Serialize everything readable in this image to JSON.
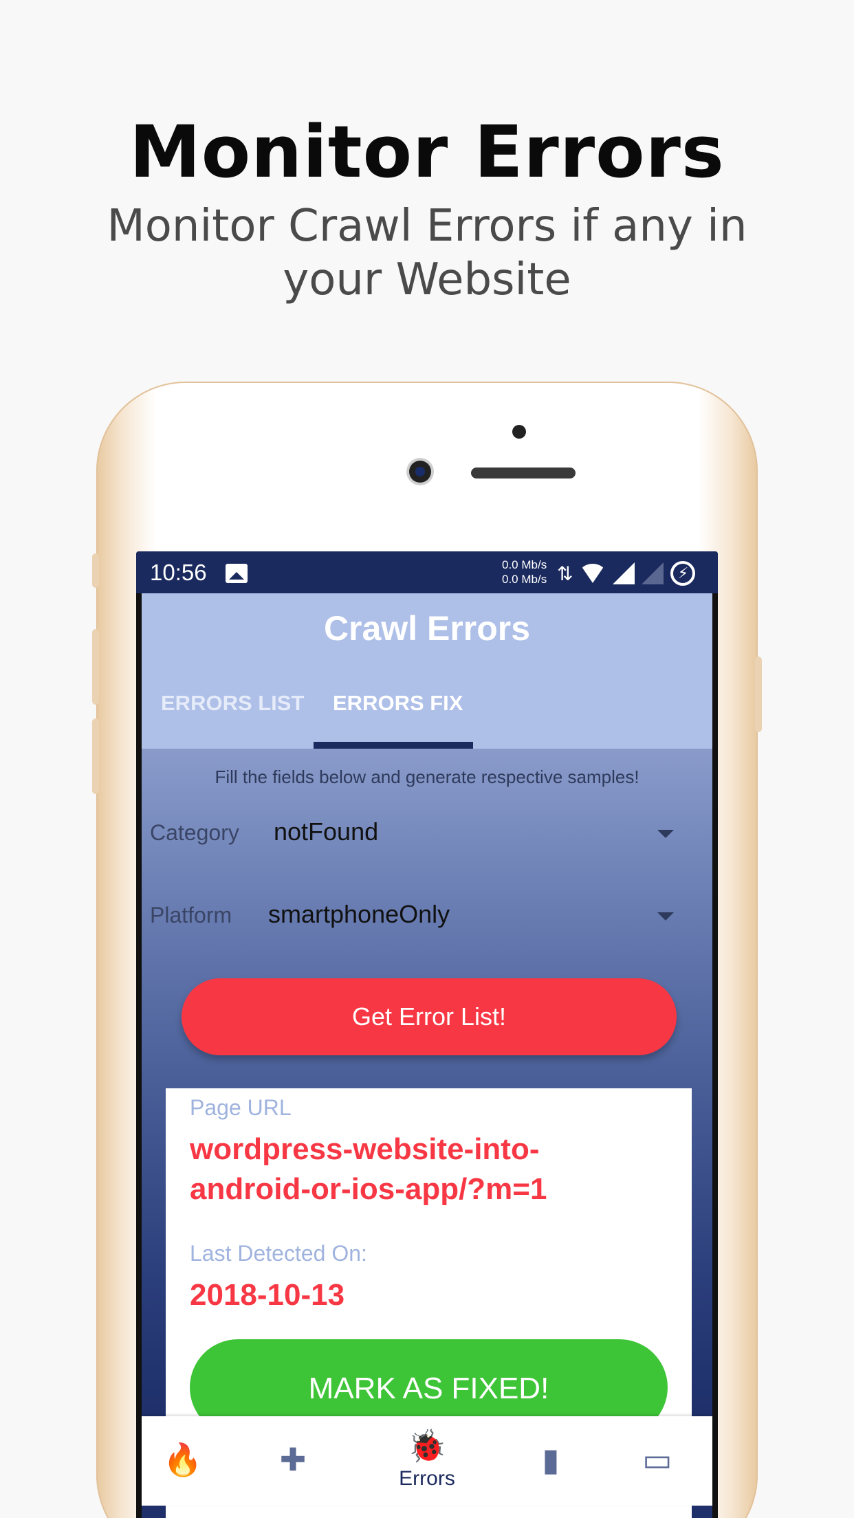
{
  "promo": {
    "headline": "Monitor Errors",
    "subline": "Monitor Crawl Errors if any in your Website"
  },
  "statusbar": {
    "time": "10:56",
    "speed_up": "0.0 Mb/s",
    "speed_down": "0.0 Mb/s",
    "icons": [
      "image-icon",
      "data-arrows-icon",
      "wifi-icon",
      "signal-icon",
      "signal-off-icon",
      "battery-charging-icon"
    ]
  },
  "app": {
    "title": "Crawl Errors",
    "tabs": [
      {
        "label": "ERRORS LIST",
        "active": false
      },
      {
        "label": "ERRORS FIX",
        "active": true
      }
    ],
    "hint": "Fill the fields below and generate respective samples!",
    "category": {
      "label": "Category",
      "value": "notFound"
    },
    "platform": {
      "label": "Platform",
      "value": "smartphoneOnly"
    },
    "get_button": "Get Error List!",
    "card": {
      "page_url_label": "Page URL",
      "page_url_value": "wordpress-website-into-android-or-ios-app/?m=1",
      "detected_label": "Last Detected On:",
      "detected_value": "2018-10-13",
      "fix_button": "MARK AS FIXED!"
    },
    "bottom_nav": [
      {
        "icon": "fire-icon",
        "glyph": "🔥",
        "label": ""
      },
      {
        "icon": "dumbbell-icon",
        "glyph": "✚",
        "label": ""
      },
      {
        "icon": "bug-icon",
        "glyph": "🐞",
        "label": "Errors"
      },
      {
        "icon": "map-icon",
        "glyph": "▮",
        "label": ""
      },
      {
        "icon": "web-icon",
        "glyph": "▭",
        "label": ""
      }
    ]
  },
  "colors": {
    "accent_red": "#f73844",
    "accent_green": "#3ec437",
    "statusbar_blue": "#1b2a5e",
    "appbar_blue": "#aebfe8"
  }
}
